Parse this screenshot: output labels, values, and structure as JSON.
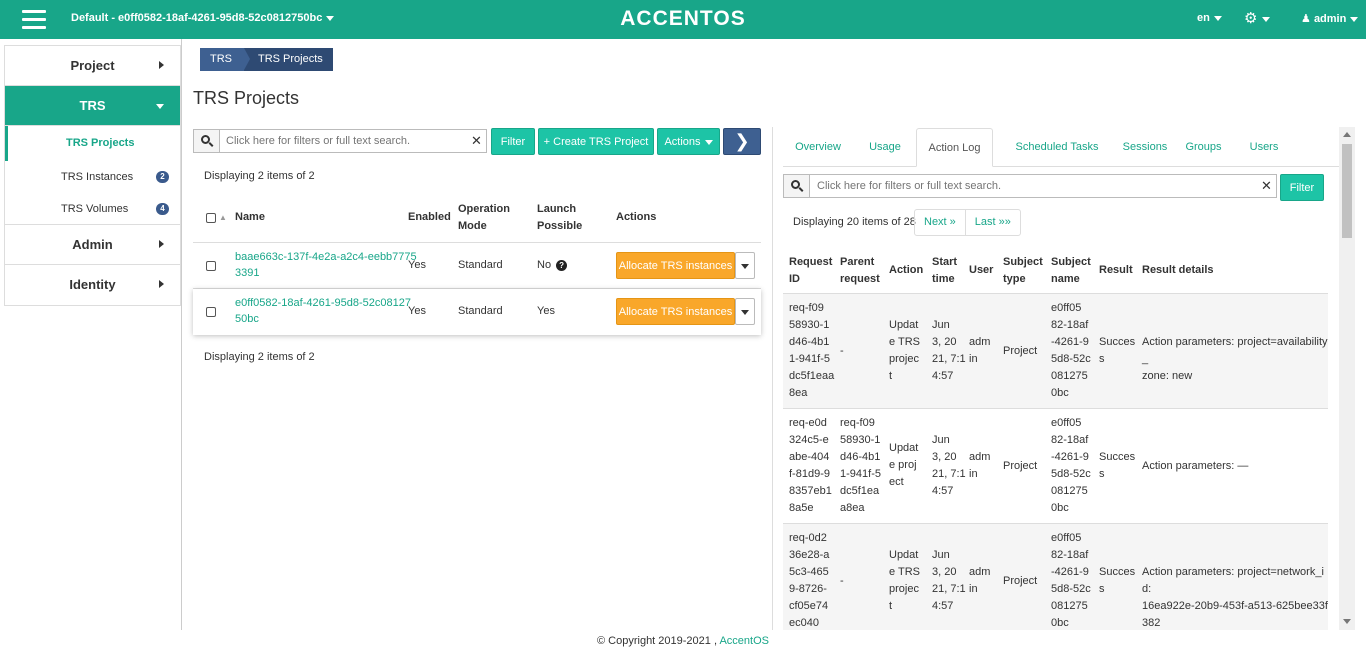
{
  "header": {
    "project": "Default - e0ff0582-18af-4261-95d8-52c0812750bc",
    "logo": "ACCENTOS",
    "lang": "en",
    "user": "admin"
  },
  "sidebar": {
    "project": "Project",
    "trs": "TRS",
    "trs_projects": "TRS Projects",
    "trs_instances": "TRS Instances",
    "trs_instances_count": "2",
    "trs_volumes": "TRS Volumes",
    "trs_volumes_count": "4",
    "admin": "Admin",
    "identity": "Identity"
  },
  "breadcrumb": [
    "TRS",
    "TRS Projects"
  ],
  "page_title": "TRS Projects",
  "left": {
    "search_placeholder": "Click here for filters or full text search.",
    "filter": "Filter",
    "create": "+ Create TRS Project",
    "actions": "Actions",
    "display_top": "Displaying 2 items of 2",
    "display_bottom": "Displaying 2 items of 2",
    "columns": {
      "name": "Name",
      "enabled": "Enabled",
      "operation_mode_1": "Operation",
      "operation_mode_2": "Mode",
      "launch_1": "Launch",
      "launch_2": "Possible",
      "actions": "Actions"
    },
    "rows": [
      {
        "name_1": "baae663c-137f-4e2a-a2c4-eebb7775",
        "name_2": "3391",
        "enabled": "Yes",
        "mode": "Standard",
        "launch": "No",
        "action": "Allocate TRS instances"
      },
      {
        "name_1": "e0ff0582-18af-4261-95d8-52c08127",
        "name_2": "50bc",
        "enabled": "Yes",
        "mode": "Standard",
        "launch": "Yes",
        "action": "Allocate TRS instances"
      }
    ]
  },
  "right": {
    "tabs": [
      "Overview",
      "Usage",
      "Action Log",
      "Scheduled Tasks",
      "Sessions",
      "Groups",
      "Users"
    ],
    "active_tab": "Action Log",
    "search_placeholder": "Click here for filters or full text search.",
    "filter": "Filter",
    "display": "Displaying 20 items of 28",
    "next": "Next »",
    "last": "Last »»",
    "columns": {
      "request_id_1": "Request",
      "request_id_2": "ID",
      "parent_1": "Parent",
      "parent_2": "request",
      "action": "Action",
      "start_1": "Start",
      "start_2": "time",
      "user": "User",
      "subject_type_1": "Subject",
      "subject_type_2": "type",
      "subject_name_1": "Subject",
      "subject_name_2": "name",
      "result": "Result",
      "result_details": "Result details"
    },
    "rows": [
      {
        "req": [
          "req-f09",
          "58930-1",
          "d46-4b1",
          "1-941f-5",
          "dc5f1eaa",
          "8ea"
        ],
        "parent": [
          "-"
        ],
        "action": [
          "Updat",
          "e TRS",
          "projec",
          "t"
        ],
        "start": [
          "Jun",
          "3, 20",
          "21, 7:1",
          "4:57"
        ],
        "user": [
          "adm",
          "in"
        ],
        "subject_type": "Project",
        "subject_name": [
          "e0ff05",
          "82-18af",
          "-4261-9",
          "5d8-52c",
          "081275",
          "0bc"
        ],
        "result": [
          "Succes",
          "s"
        ],
        "details": [
          "Action parameters: project=availability_",
          "zone: new"
        ]
      },
      {
        "req": [
          "req-e0d",
          "324c5-e",
          "abe-404",
          "f-81d9-9",
          "8357eb1",
          "8a5e"
        ],
        "parent": [
          "req-f09",
          "58930-1",
          "d46-4b1",
          "1-941f-5",
          "dc5f1ea",
          "a8ea"
        ],
        "action": [
          "Updat",
          "e proj",
          "ect"
        ],
        "start": [
          "Jun",
          "3, 20",
          "21, 7:1",
          "4:57"
        ],
        "user": [
          "adm",
          "in"
        ],
        "subject_type": "Project",
        "subject_name": [
          "e0ff05",
          "82-18af",
          "-4261-9",
          "5d8-52c",
          "081275",
          "0bc"
        ],
        "result": [
          "Succes",
          "s"
        ],
        "details": [
          "Action parameters: —"
        ]
      },
      {
        "req": [
          "req-0d2",
          "36e28-a",
          "5c3-465",
          "9-8726-",
          "cf05e74",
          "ec040"
        ],
        "parent": [
          "-"
        ],
        "action": [
          "Updat",
          "e TRS",
          "projec",
          "t"
        ],
        "start": [
          "Jun",
          "3, 20",
          "21, 7:1",
          "4:57"
        ],
        "user": [
          "adm",
          "in"
        ],
        "subject_type": "Project",
        "subject_name": [
          "e0ff05",
          "82-18af",
          "-4261-9",
          "5d8-52c",
          "081275",
          "0bc"
        ],
        "result": [
          "Succes",
          "s"
        ],
        "details": [
          "Action parameters: project=network_id:",
          "16ea922e-20b9-453f-a513-625bee33f382"
        ]
      }
    ]
  },
  "footer": {
    "copyright": "© Copyright 2019-2021 ,",
    "brand": "AccentOS"
  },
  "colors": {
    "accent": "#18a689",
    "teal_button": "#1dc4a6",
    "dark_blue": "#3e6091",
    "orange": "#f9a72a"
  }
}
